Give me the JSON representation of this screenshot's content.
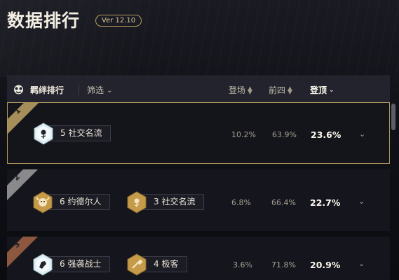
{
  "page": {
    "title": "数据排行",
    "version": "Ver 12.10"
  },
  "header": {
    "tab_label": "羁绊排行",
    "filter_label": "筛选",
    "sort_columns": [
      {
        "label": "登场",
        "active": false
      },
      {
        "label": "前四",
        "active": false
      },
      {
        "label": "登顶",
        "active": true
      }
    ]
  },
  "rows": [
    {
      "rank": "1",
      "rank_color": "#a68e5a",
      "traits": [
        {
          "label": "5 社交名流",
          "tier": "diamond",
          "icon": "rose-icon"
        }
      ],
      "appearance": "10.2%",
      "top4": "63.9%",
      "top1": "23.6%",
      "selected": true
    },
    {
      "rank": "2",
      "rank_color": "#8a8a8c",
      "traits": [
        {
          "label": "6 约德尔人",
          "tier": "gold",
          "icon": "yordle-icon"
        },
        {
          "label": "3 社交名流",
          "tier": "gold",
          "icon": "rose-icon"
        }
      ],
      "appearance": "6.8%",
      "top4": "66.4%",
      "top1": "22.7%",
      "selected": false
    },
    {
      "rank": "3",
      "rank_color": "#8e5840",
      "traits": [
        {
          "label": "6 强袭战士",
          "tier": "diamond",
          "icon": "bruiser-fist-icon"
        },
        {
          "label": "4 极客",
          "tier": "gold",
          "icon": "wrench-icon"
        }
      ],
      "appearance": "3.6%",
      "top4": "71.8%",
      "top1": "20.9%",
      "selected": false
    }
  ],
  "colors": {
    "accent_gold": "#b59b5e",
    "diamond_tier": "#dfeef3",
    "gold_tier": "#c59b4a"
  }
}
